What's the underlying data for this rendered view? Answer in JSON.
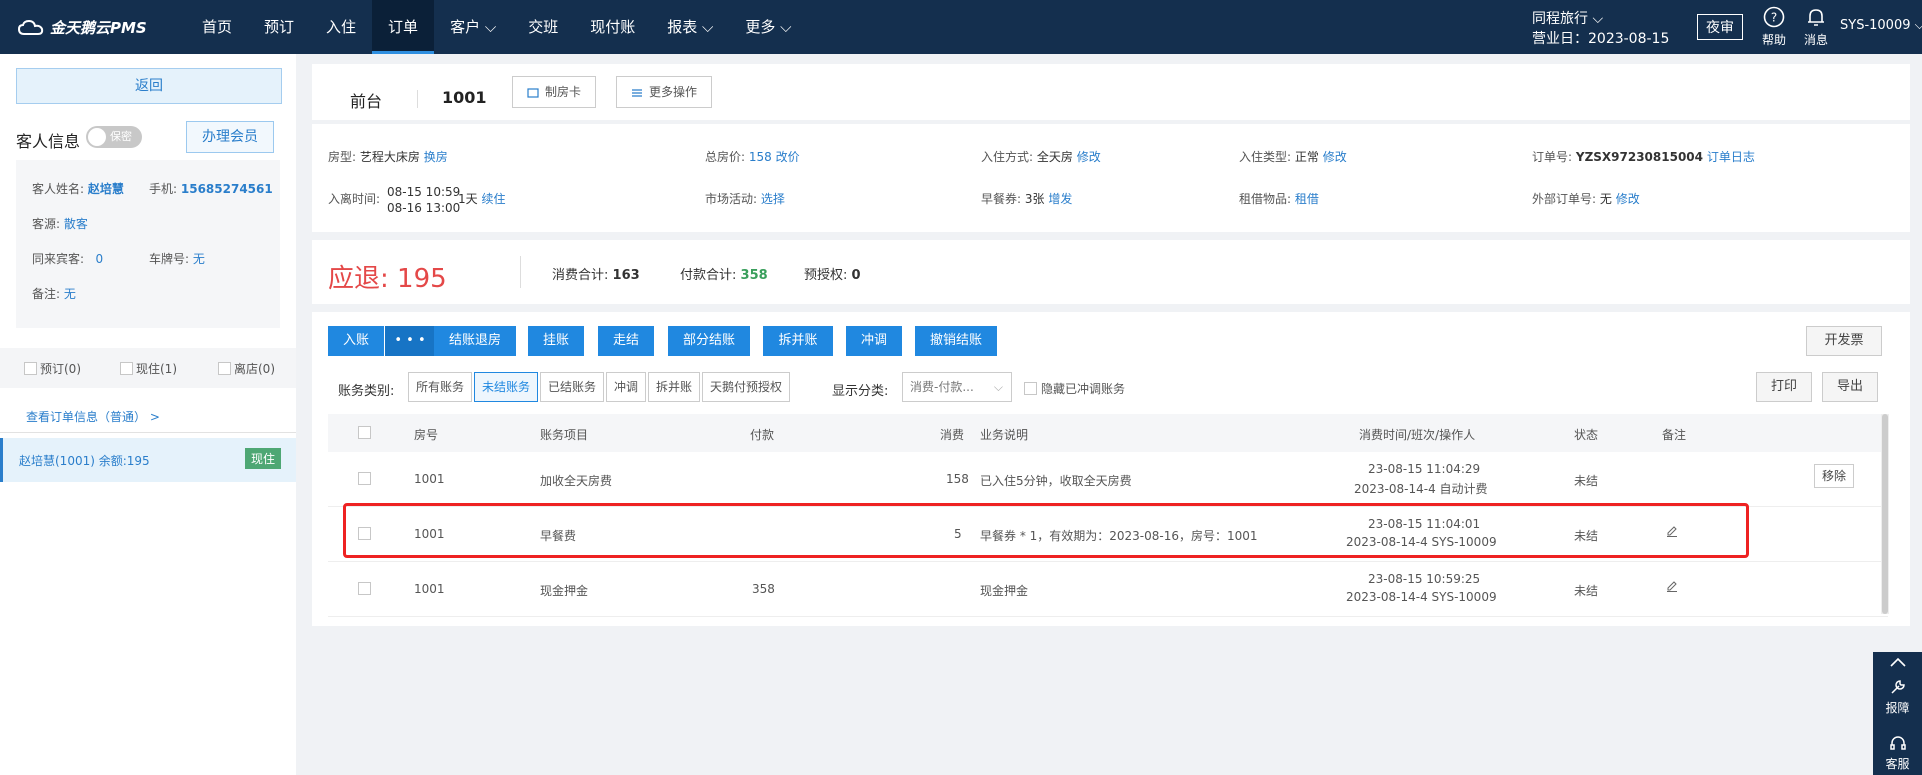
{
  "app": {
    "logo": "金天鹅云PMS"
  },
  "nav": {
    "items": [
      {
        "label": "首页"
      },
      {
        "label": "预订"
      },
      {
        "label": "入住"
      },
      {
        "label": "订单"
      },
      {
        "label": "客户 ⌵"
      },
      {
        "label": "交班"
      },
      {
        "label": "现付账"
      },
      {
        "label": "报表 ⌵"
      },
      {
        "label": "更多 ⌵"
      }
    ]
  },
  "header": {
    "hotel": "同程旅行 ⌵",
    "business_date": "营业日：2023-08-15",
    "night_audit": "夜审",
    "help": "帮助",
    "messages": "消息",
    "user": "SYS-10009 ⌵"
  },
  "left": {
    "return": "返回",
    "guest_info_title": "客人信息",
    "privacy_toggle": "保密",
    "member_button": "办理会员",
    "guest_name_label": "客人姓名:",
    "guest_name": "赵培慧",
    "phone_label": "手机:",
    "phone": "15685274561",
    "source_label": "客源:",
    "source": "散客",
    "companions_label": "同来宾客:",
    "companions": "0",
    "plate_label": "车牌号:",
    "plate": "无",
    "remark_label": "备注:",
    "remark": "无",
    "status_reserved": "预订(0)",
    "status_checked_in": "现住(1)",
    "status_left": "离店(0)",
    "order_info_link": "查看订单信息（普通） >",
    "guest_row": "赵培慧(1001)  余额:195",
    "guest_row_badge": "现住"
  },
  "roombar": {
    "tag": "前台",
    "room_no": "1001",
    "make_card": "制房卡",
    "more_ops": "更多操作"
  },
  "info": {
    "room_type_label": "房型:",
    "room_type": "艺程大床房",
    "change_room": "换房",
    "total_price_label": "总房价:",
    "total_price": "158",
    "change_price": "改价",
    "checkin_method_label": "入住方式:",
    "checkin_method": "全天房",
    "modify1": "修改",
    "checkin_type_label": "入住类型:",
    "checkin_type": "正常",
    "modify2": "修改",
    "order_no_label": "订单号:",
    "order_no": "YZSX97230815004",
    "order_log": "订单日志",
    "inout_label": "入离时间:",
    "inout_in": "08-15 10:59",
    "inout_out": "08-16 13:00",
    "inout_days": "1天",
    "extend": "续住",
    "market_label": "市场活动:",
    "market": "选择",
    "breakfast_label": "早餐券:",
    "breakfast": "3张",
    "breakfast_add": "增发",
    "rental_label": "租借物品:",
    "rental": "租借",
    "external_label": "外部订单号:",
    "external": "无",
    "modify3": "修改"
  },
  "summary": {
    "refund_label": "应退:",
    "refund_value": "195",
    "consume_label": "消费合计:",
    "consume": "163",
    "pay_label": "付款合计:",
    "pay": "358",
    "preauth_label": "预授权:",
    "preauth": "0"
  },
  "actions": {
    "post": "入账",
    "more": "• • •",
    "settle_checkout": "结账退房",
    "hang": "挂账",
    "walkout": "走结",
    "partial": "部分结账",
    "split": "拆并账",
    "adjust": "冲调",
    "cancel_settle": "撤销结账",
    "invoice": "开发票"
  },
  "filters": {
    "category_label": "账务类别:",
    "tabs": [
      "所有账务",
      "未结账务",
      "已结账务",
      "冲调",
      "拆并账",
      "天鹅付预授权"
    ],
    "display_label": "显示分类:",
    "display_select": "消费-付款...",
    "hide_adjust": "隐藏已冲调账务",
    "print": "打印",
    "export": "导出"
  },
  "table": {
    "headers": [
      "房号",
      "账务项目",
      "付款",
      "消费",
      "业务说明",
      "消费时间/班次/操作人",
      "状态",
      "备注"
    ],
    "rows": [
      {
        "room": "1001",
        "item": "加收全天房费",
        "pay": "",
        "consume": "158",
        "desc": "已入住5分钟，收取全天房费",
        "time": "23-08-15 11:04:29",
        "shift": "2023-08-14-4 自动计费",
        "status": "未结",
        "action": "移除"
      },
      {
        "room": "1001",
        "item": "早餐费",
        "pay": "",
        "consume": "5",
        "desc": "早餐券 * 1，有效期为：2023-08-16，房号：1001",
        "time": "23-08-15 11:04:01",
        "shift": "2023-08-14-4 SYS-10009",
        "status": "未结",
        "action": ""
      },
      {
        "room": "1001",
        "item": "现金押金",
        "pay": "358",
        "consume": "",
        "desc": "现金押金",
        "time": "23-08-15 10:59:25",
        "shift": "2023-08-14-4 SYS-10009",
        "status": "未结",
        "action": ""
      }
    ]
  },
  "side_tools": {
    "report": "报障",
    "service": "客服"
  },
  "colors": {
    "topbar": "#142f4e",
    "accent": "#2088e0",
    "danger": "#e44848",
    "success": "#3a9f5c"
  }
}
